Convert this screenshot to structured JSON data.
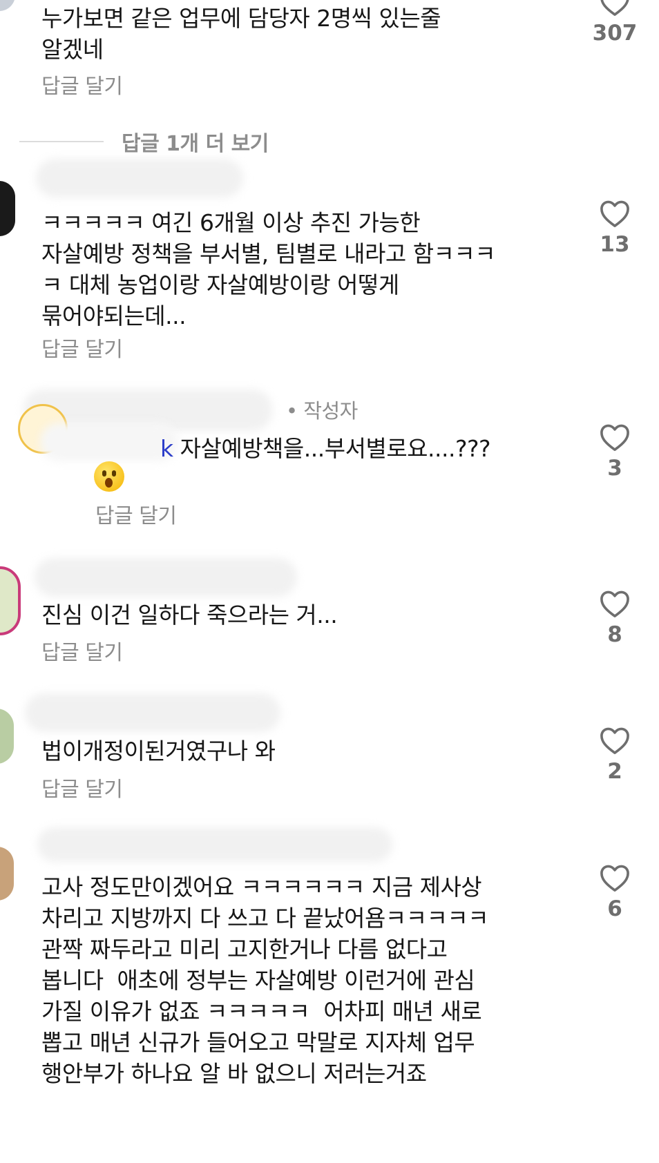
{
  "comments": [
    {
      "text": "누가보면 같은 업무에 담당자 2명씩 있는줄\n알겠네",
      "reply": "답글 달기",
      "likes": "307"
    },
    {
      "text": "ㅋㅋㅋㅋㅋ 여긴 6개월 이상 추진 가능한\n자살예방 정책을 부서별, 팀별로 내라고 함ㅋㅋㅋ\nㅋ 대체 농업이랑 자살예방이랑 어떻게\n묶어야되는데...",
      "reply": "답글 달기",
      "likes": "13"
    },
    {
      "author_tag": "• 작성자",
      "mention": "k",
      "text": " 자살예방책을...부서별로요....???",
      "reply": "답글 달기",
      "likes": "3"
    },
    {
      "text": "진심 이건 일하다 죽으라는 거...",
      "reply": "답글 달기",
      "likes": "8"
    },
    {
      "text": "법이개정이된거였구나 와",
      "reply": "답글 달기",
      "likes": "2"
    },
    {
      "text": "고사 정도만이겠어요 ㅋㅋㅋㅋㅋㅋ 지금 제사상\n차리고 지방까지 다 쓰고 다 끝났어욤ㅋㅋㅋㅋㅋ\n관짝 짜두라고 미리 고지한거나 다름 없다고\n봅니다  애초에 정부는 자살예방 이런거에 관심\n가질 이유가 없죠 ㅋㅋㅋㅋㅋ  어차피 매년 새로\n뽑고 매년 신규가 들어오고 막말로 지자체 업무\n행안부가 하나요 알 바 없으니 저러는거죠",
      "likes": "6"
    }
  ],
  "more_replies": "답글 1개 더 보기",
  "icons": {
    "like": "heart-outline-icon"
  },
  "colors": {
    "secondary_text": "#8c8c8c",
    "mention": "#2c3ec9"
  }
}
